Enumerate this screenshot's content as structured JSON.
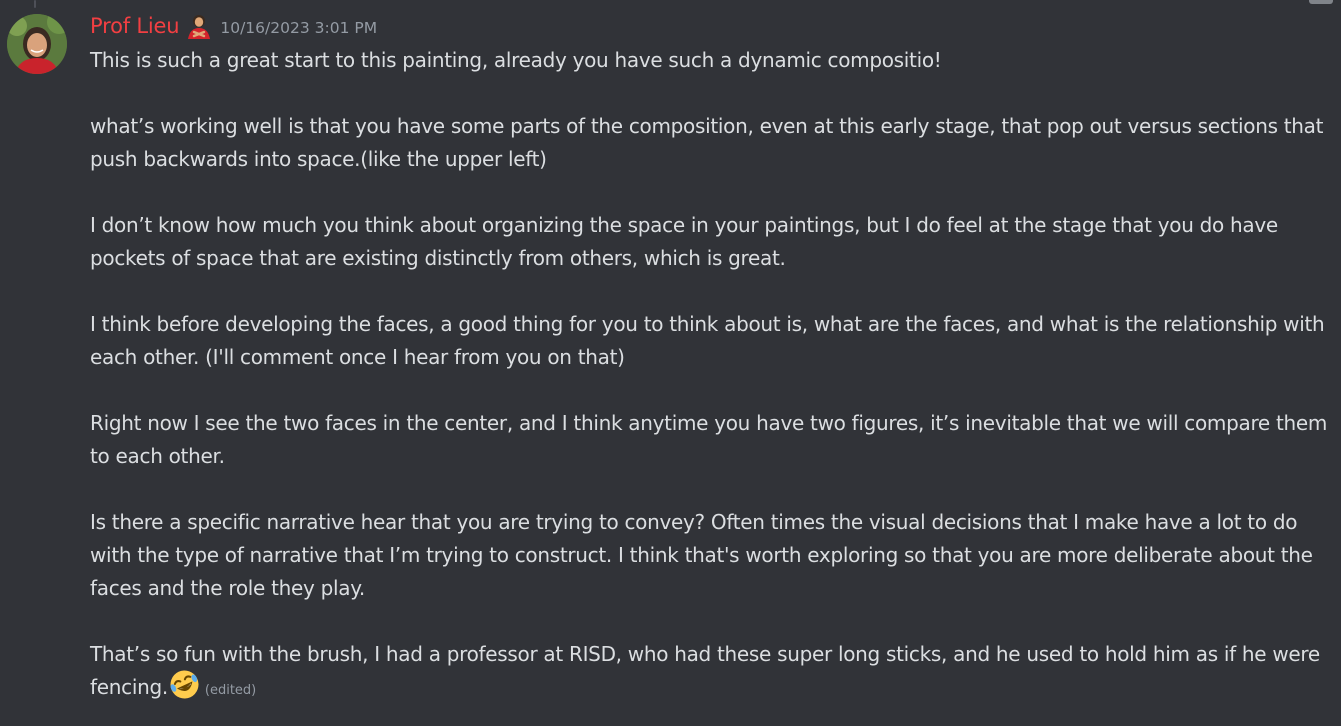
{
  "message": {
    "author": "Prof Lieu",
    "timestamp": "10/16/2023 3:01 PM",
    "paragraphs": [
      "This is such a great start to this painting, already you have such a dynamic compositio!",
      "what’s working well is that you have some parts of the composition, even at this early stage, that pop out versus sections that push backwards into space.(like the upper left)",
      "I don’t know how much you think about organizing the space in your paintings, but I do feel at the stage that you do have pockets of space that are existing distinctly from others, which is great.",
      "I think before developing the faces, a good thing for you to think about is, what are the faces, and what is the relationship with each other. (I'll comment once I hear from you on that)",
      "Right now I see the two faces in the center, and I think anytime you have two figures, it’s inevitable that we will compare them to each other.",
      "Is there a specific narrative hear that you are trying to convey? Often times the visual decisions that I make have a lot to do with the type of narrative that I’m trying to construct. I think that's worth exploring so that you are more deliberate about the faces and the role they play.",
      "That’s so fun with the brush, I had a professor at RISD, who had these super long sticks, and he used to hold him as if he were fencing."
    ],
    "edited_label": "(edited)",
    "author_color": "#f23f42",
    "role_icon": "person-emoji-icon",
    "end_emoji": "rolling-on-floor-laughing-icon"
  }
}
